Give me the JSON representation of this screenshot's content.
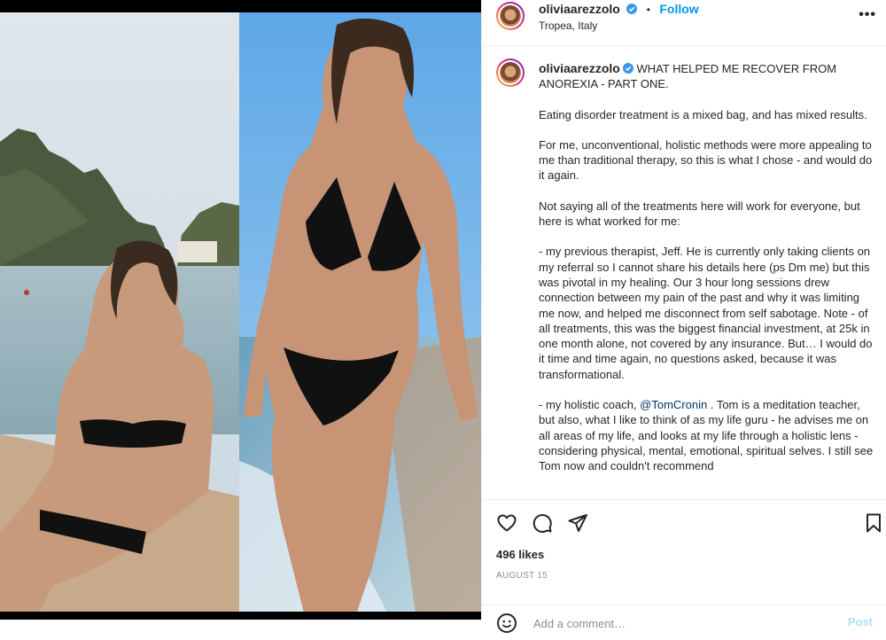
{
  "post": {
    "username": "oliviaarezzolo",
    "follow_label": "Follow",
    "location": "Tropea, Italy",
    "more_label": "•••"
  },
  "caption": {
    "username": "oliviaarezzolo",
    "title": "WHAT HELPED ME RECOVER FROM ANOREXIA - PART ONE.",
    "p1": "Eating disorder treatment is a mixed bag, and has mixed results.",
    "p2": "For me, unconventional, holistic methods were more appealing to me than traditional therapy, so this is what I chose - and would do it again.",
    "p3": "Not saying all of the treatments here will work for everyone, but here is what worked for me:",
    "p4": "- my previous therapist, Jeff. He is currently only taking clients on my referral so I cannot share his details here (ps Dm me) but this was pivotal in my healing. Our 3 hour long sessions drew connection between my pain of the past and why it was limiting me now, and helped me disconnect from self sabotage. Note - of all treatments, this was the biggest financial investment, at 25k in one month alone, not covered by any insurance. But… I would do it time and time again, no questions asked, because it was transformational.",
    "p5_before": "- my holistic coach, ",
    "p5_mention": "@TomCronin",
    "p5_after": " . Tom is a meditation teacher, but also, what I like to think of as my life guru - he advises me on all areas of my life, and looks at my life through a holistic lens - considering physical, mental, emotional, spiritual selves. I still see Tom now and couldn't recommend"
  },
  "actions": {
    "like_icon": "heart-icon",
    "comment_icon": "comment-icon",
    "share_icon": "share-icon",
    "save_icon": "bookmark-icon",
    "likes": "496 likes",
    "date": "AUGUST 15"
  },
  "comment": {
    "emoji_icon": "emoji-icon",
    "placeholder": "Add a comment…",
    "post_label": "Post"
  },
  "colors": {
    "accent": "#0095f6",
    "verified": "#3897f0",
    "mention": "#00376b"
  }
}
